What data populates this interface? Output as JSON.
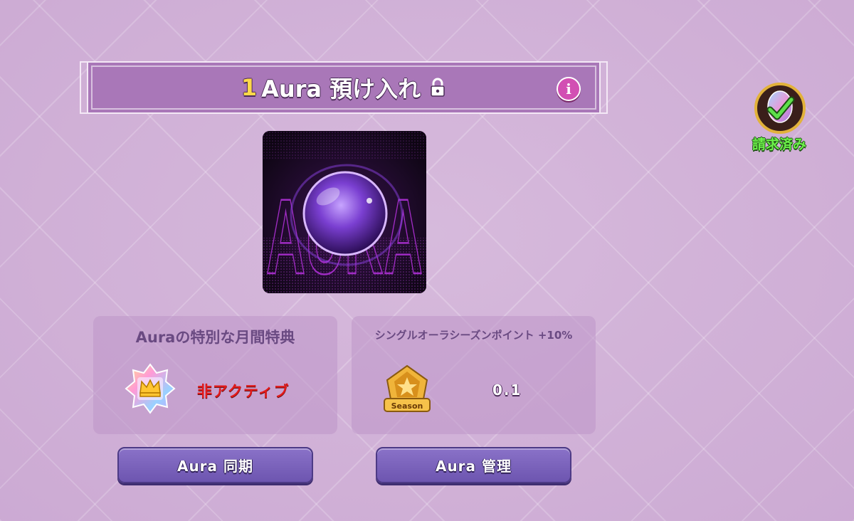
{
  "header": {
    "title_number": "1",
    "title_text": "Aura 預け入れ",
    "lock_icon": "lock-icon",
    "info_icon_label": "i"
  },
  "claimed_badge": {
    "label": "請求済み",
    "icon": "egg-check-icon"
  },
  "art": {
    "icon": "aura-orb-image",
    "word_art": "AURA"
  },
  "panels": {
    "monthly_bonus": {
      "title": "Auraの特別な月間特典",
      "icon": "crown-star-badge-icon",
      "status": "非アクティブ"
    },
    "season_points": {
      "title": "シングルオーラシーズンポイント +10%",
      "icon": "season-badge-icon",
      "badge_text": "Season",
      "value": "0.1"
    }
  },
  "buttons": {
    "sync_label": "Aura 同期",
    "manage_label": "Aura 管理"
  },
  "colors": {
    "background": "#d2b2d8",
    "banner": "#a977b8",
    "status_inactive": "#e21a1a",
    "button": "#7a63bd",
    "claimed_text": "#6cf04a"
  }
}
